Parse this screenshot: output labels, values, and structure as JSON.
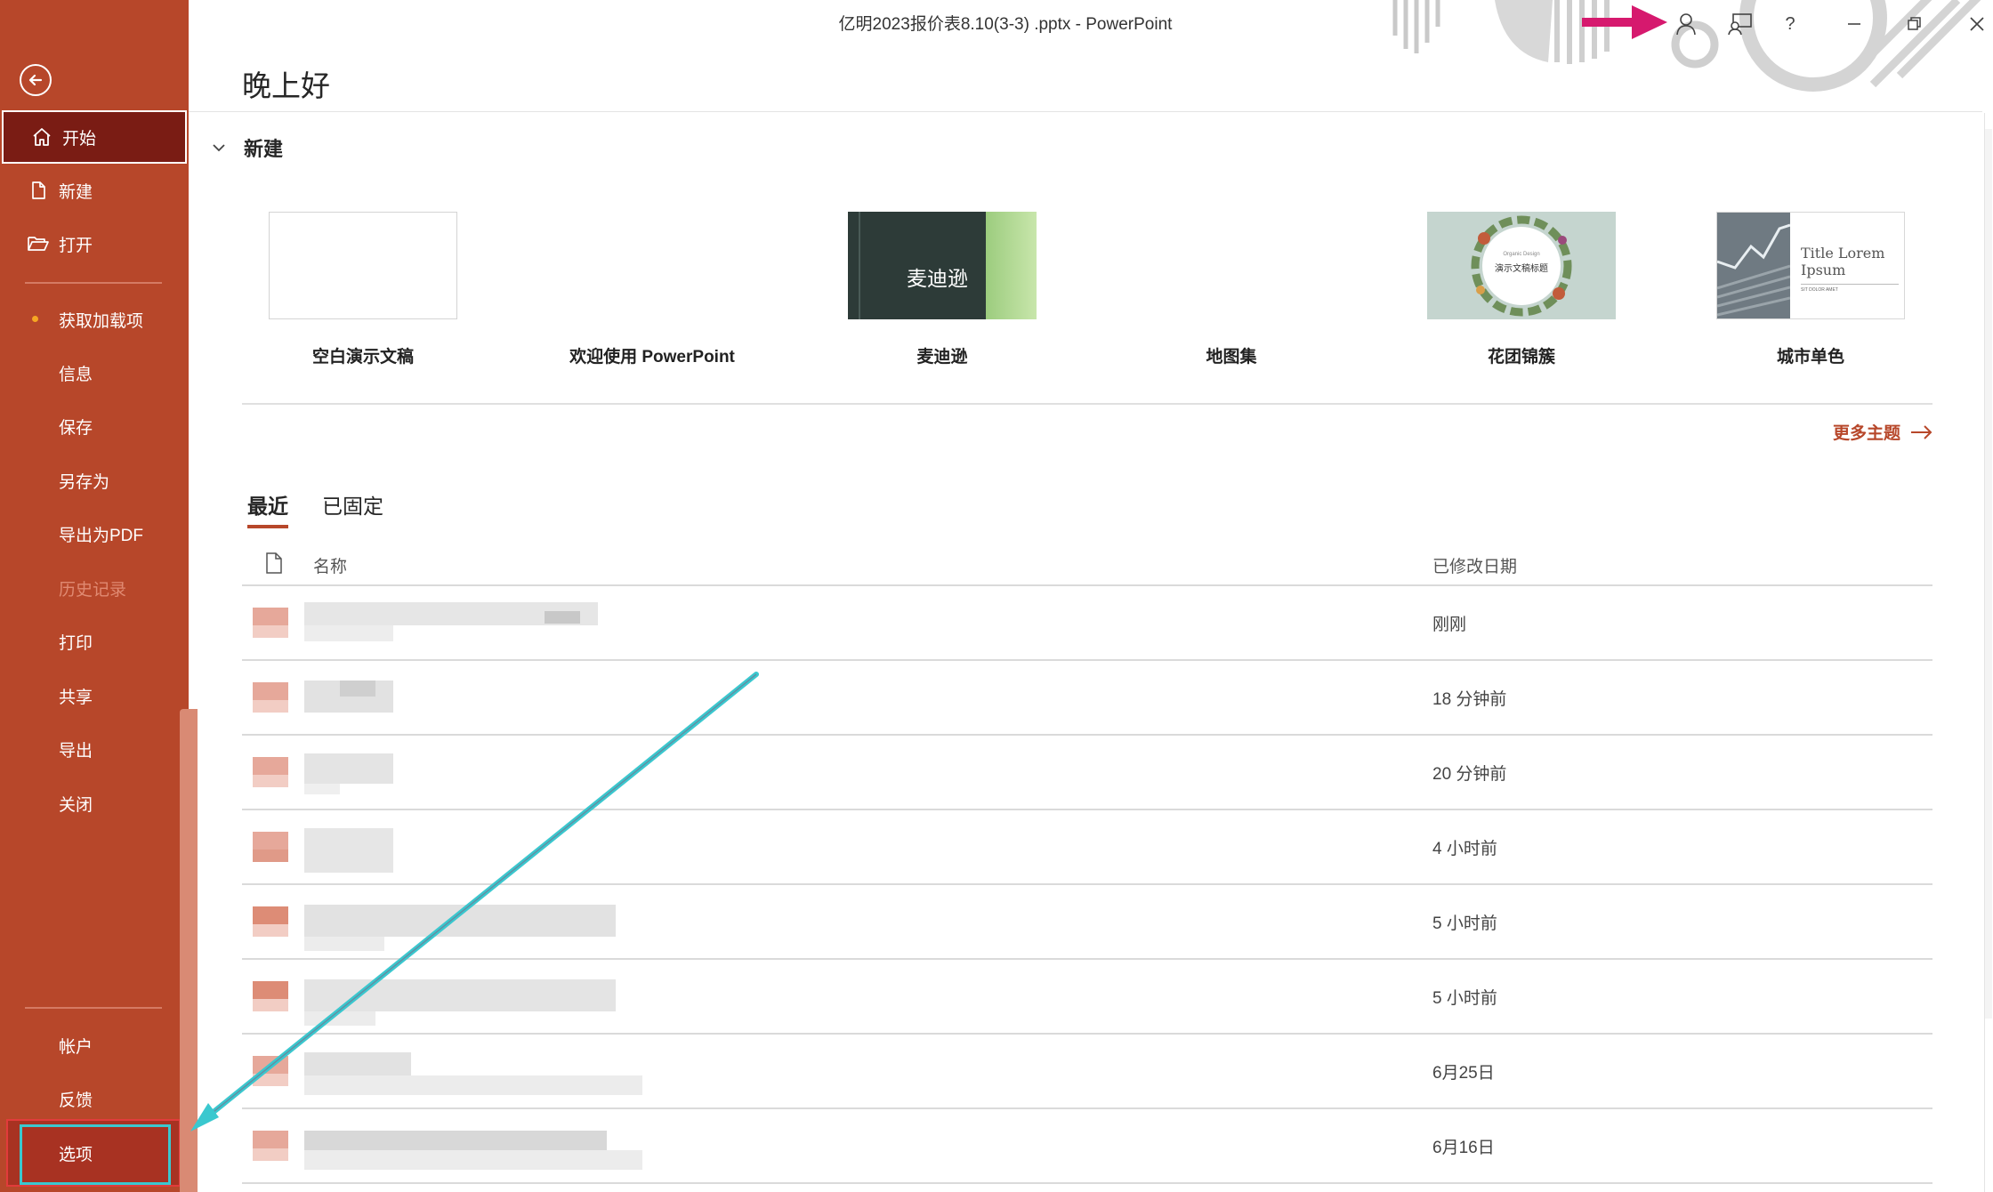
{
  "window": {
    "title": "亿明2023报价表8.10(3-3) .pptx  -  PowerPoint",
    "help_label": "?"
  },
  "sidebar": {
    "items": [
      {
        "label": "开始"
      },
      {
        "label": "新建"
      },
      {
        "label": "打开"
      },
      {
        "label": "获取加载项"
      },
      {
        "label": "信息"
      },
      {
        "label": "保存"
      },
      {
        "label": "另存为"
      },
      {
        "label": "导出为PDF"
      },
      {
        "label": "历史记录"
      },
      {
        "label": "打印"
      },
      {
        "label": "共享"
      },
      {
        "label": "导出"
      },
      {
        "label": "关闭"
      }
    ],
    "bottom": [
      {
        "label": "帐户"
      },
      {
        "label": "反馈"
      },
      {
        "label": "选项"
      }
    ]
  },
  "main": {
    "greeting": "晚上好",
    "new_section": "新建",
    "templates": [
      {
        "name": "空白演示文稿"
      },
      {
        "name": "欢迎使用 PowerPoint"
      },
      {
        "name": "麦迪逊",
        "thumb_text": "麦迪逊"
      },
      {
        "name": "地图集"
      },
      {
        "name": "花团锦簇",
        "thumb_text": "演示文稿标题",
        "thumb_small": "Organic Design"
      },
      {
        "name": "城市单色",
        "thumb_text": "Title Lorem Ipsum",
        "thumb_small": "SIT DOLOR AMET"
      }
    ],
    "more_themes": "更多主题",
    "tabs": [
      {
        "label": "最近"
      },
      {
        "label": "已固定"
      }
    ],
    "columns": {
      "name": "名称",
      "modified": "已修改日期"
    },
    "files": [
      {
        "modified": "刚刚"
      },
      {
        "modified": "18 分钟前"
      },
      {
        "modified": "20 分钟前"
      },
      {
        "modified": "4 小时前"
      },
      {
        "modified": "5 小时前"
      },
      {
        "modified": "5 小时前"
      },
      {
        "modified": "6月25日"
      },
      {
        "modified": "6月16日"
      }
    ]
  },
  "colors": {
    "brand": "#b7472a",
    "active": "#7a1c14",
    "annotation_arrow": "#3ac8cf",
    "annotation_pink": "#d6196e"
  }
}
